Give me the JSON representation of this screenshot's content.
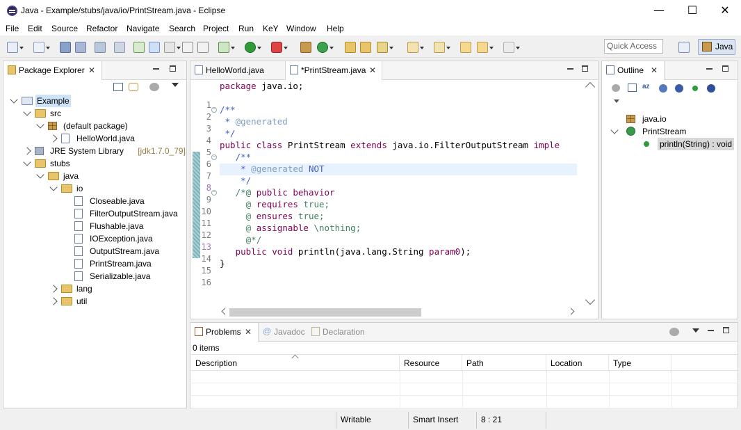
{
  "window": {
    "title": "Java - Example/stubs/java/io/PrintStream.java - Eclipse",
    "minimize": "—",
    "maximize": "☐",
    "close": "✕"
  },
  "menu": [
    "File",
    "Edit",
    "Source",
    "Refactor",
    "Navigate",
    "Search",
    "Project",
    "Run",
    "KeY",
    "Window",
    "Help"
  ],
  "toolbar": {
    "quick_access_placeholder": "Quick Access",
    "perspective": "Java"
  },
  "package_explorer": {
    "title": "Package Explorer",
    "tree": [
      {
        "label": "Example",
        "type": "project",
        "depth": 0,
        "expanded": true,
        "selected": true
      },
      {
        "label": "src",
        "type": "folder",
        "depth": 1,
        "expanded": true
      },
      {
        "label": "(default package)",
        "type": "package",
        "depth": 2,
        "expanded": true
      },
      {
        "label": "HelloWorld.java",
        "type": "file",
        "depth": 3,
        "expanded": false
      },
      {
        "label": "JRE System Library",
        "suffix": "[jdk1.7.0_79]",
        "type": "library",
        "depth": 1,
        "expanded": false
      },
      {
        "label": "stubs",
        "type": "folder",
        "depth": 1,
        "expanded": true
      },
      {
        "label": "java",
        "type": "folder",
        "depth": 2,
        "expanded": true
      },
      {
        "label": "io",
        "type": "folder",
        "depth": 3,
        "expanded": true
      },
      {
        "label": "Closeable.java",
        "type": "file",
        "depth": 4
      },
      {
        "label": "FilterOutputStream.java",
        "type": "file",
        "depth": 4
      },
      {
        "label": "Flushable.java",
        "type": "file",
        "depth": 4
      },
      {
        "label": "IOException.java",
        "type": "file",
        "depth": 4
      },
      {
        "label": "OutputStream.java",
        "type": "file",
        "depth": 4
      },
      {
        "label": "PrintStream.java",
        "type": "file",
        "depth": 4
      },
      {
        "label": "Serializable.java",
        "type": "file",
        "depth": 4
      },
      {
        "label": "lang",
        "type": "folder",
        "depth": 3,
        "expanded": false
      },
      {
        "label": "util",
        "type": "folder",
        "depth": 3,
        "expanded": false
      }
    ]
  },
  "editor": {
    "tabs": [
      {
        "label": "HelloWorld.java",
        "active": false
      },
      {
        "label": "*PrintStream.java",
        "active": true
      }
    ],
    "lines": [
      {
        "n": "1",
        "html": "<span class='kw'>package</span> java.io;"
      },
      {
        "n": "2",
        "html": ""
      },
      {
        "n": "3",
        "html": "<span class='jd'>/**</span>",
        "fold": true
      },
      {
        "n": "4",
        "html": "<span class='jd'> * </span><span class='jdtag'>@generated</span>"
      },
      {
        "n": "5",
        "html": "<span class='jd'> */</span>"
      },
      {
        "n": "6",
        "html": "<span class='kw'>public</span> <span class='kw'>class</span> PrintStream <span class='kw'>extends</span> java.io.FilterOutputStream <span class='kw'>imple</span>"
      },
      {
        "n": "7",
        "html": "   <span class='jd'>/**</span>",
        "fold": true
      },
      {
        "n": "8",
        "html": "    <span class='jd'>* </span><span class='jdtag'>@generated</span><span class='jd'> NOT</span>",
        "current": true
      },
      {
        "n": "9",
        "html": "    <span class='jd'>*/</span>"
      },
      {
        "n": "10",
        "html": "   <span class='cm'>/*@ </span><span class='jml'>public behavior</span>",
        "fold": true
      },
      {
        "n": "11",
        "html": "     <span class='cm'>@ </span><span class='jml'>requires</span><span class='cm'> true;</span>"
      },
      {
        "n": "12",
        "html": "     <span class='cm'>@ </span><span class='jml'>ensures</span><span class='cm'> true;</span>"
      },
      {
        "n": "13",
        "html": "     <span class='cm'>@ </span><span class='jml'>assignable</span><span class='cm'> \\nothing;</span>"
      },
      {
        "n": "14",
        "html": "     <span class='cm'>@*/</span>"
      },
      {
        "n": "15",
        "html": "   <span class='kw'>public</span> <span class='kw'>void</span> println(java.lang.String <span class='jml'>param0</span>);"
      },
      {
        "n": "16",
        "html": "}"
      }
    ]
  },
  "outline": {
    "title": "Outline",
    "items": [
      {
        "label": "java.io",
        "type": "package",
        "depth": 0
      },
      {
        "label": "PrintStream",
        "type": "class",
        "depth": 0,
        "expanded": true
      },
      {
        "label": "println(String) : void",
        "type": "method",
        "depth": 1,
        "selected": true
      }
    ]
  },
  "problems": {
    "tabs": [
      {
        "label": "Problems",
        "active": true
      },
      {
        "label": "Javadoc",
        "active": false
      },
      {
        "label": "Declaration",
        "active": false
      }
    ],
    "count": "0 items",
    "columns": [
      "Description",
      "Resource",
      "Path",
      "Location",
      "Type"
    ]
  },
  "status": {
    "mode": "Writable",
    "insert": "Smart Insert",
    "position": "8 : 21"
  }
}
